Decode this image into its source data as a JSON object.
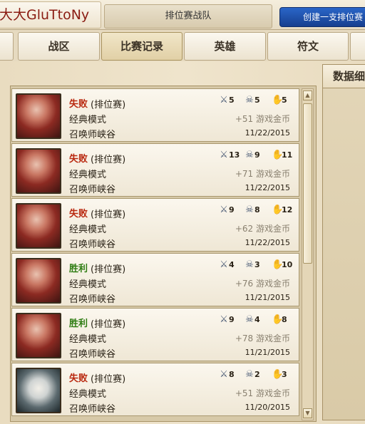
{
  "header": {
    "player_name": "大大GluTtoNy",
    "team_tab": "排位赛战队",
    "create_button": "创建一支排位赛"
  },
  "tabs": [
    {
      "label": "战区",
      "active": false
    },
    {
      "label": "比赛记录",
      "active": true
    },
    {
      "label": "英雄",
      "active": false
    },
    {
      "label": "符文",
      "active": false
    }
  ],
  "detail_panel": {
    "title": "数据细"
  },
  "colors": {
    "loss": "#b9280f",
    "win": "#2f7d13"
  },
  "matches": [
    {
      "result": "失败",
      "outcome": "loss",
      "queue": "(排位赛)",
      "mode": "经典模式",
      "map": "召唤师峡谷",
      "kills": "5",
      "deaths": "5",
      "assists": "5",
      "gold": "+51 游戏金币",
      "date": "11/22/2015",
      "champion_icon": "red-champion-portrait"
    },
    {
      "result": "失败",
      "outcome": "loss",
      "queue": "(排位赛)",
      "mode": "经典模式",
      "map": "召唤师峡谷",
      "kills": "13",
      "deaths": "9",
      "assists": "11",
      "gold": "+71 游戏金币",
      "date": "11/22/2015",
      "champion_icon": "red-champion-portrait"
    },
    {
      "result": "失败",
      "outcome": "loss",
      "queue": "(排位赛)",
      "mode": "经典模式",
      "map": "召唤师峡谷",
      "kills": "9",
      "deaths": "8",
      "assists": "12",
      "gold": "+62 游戏金币",
      "date": "11/22/2015",
      "champion_icon": "red-champion-portrait"
    },
    {
      "result": "胜利",
      "outcome": "win",
      "queue": "(排位赛)",
      "mode": "经典模式",
      "map": "召唤师峡谷",
      "kills": "4",
      "deaths": "3",
      "assists": "10",
      "gold": "+76 游戏金币",
      "date": "11/21/2015",
      "champion_icon": "red-champion-portrait"
    },
    {
      "result": "胜利",
      "outcome": "win",
      "queue": "(排位赛)",
      "mode": "经典模式",
      "map": "召唤师峡谷",
      "kills": "9",
      "deaths": "4",
      "assists": "8",
      "gold": "+78 游戏金币",
      "date": "11/21/2015",
      "champion_icon": "red-champion-portrait"
    },
    {
      "result": "失败",
      "outcome": "loss",
      "queue": "(排位赛)",
      "mode": "经典模式",
      "map": "召唤师峡谷",
      "kills": "8",
      "deaths": "2",
      "assists": "3",
      "gold": "+51 游戏金币",
      "date": "11/20/2015",
      "champion_icon": "white-champion-portrait"
    }
  ]
}
